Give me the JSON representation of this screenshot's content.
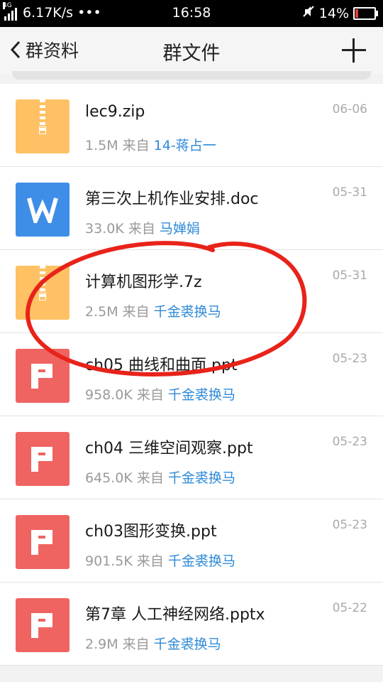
{
  "status_bar": {
    "network_speed": "6.17K/s",
    "dots": "•••",
    "time": "16:58",
    "battery_percent": "14%",
    "signal_tag": "4G",
    "battery_level": 0.14
  },
  "nav": {
    "back_label": "群资料",
    "title": "群文件"
  },
  "files": [
    {
      "name": "lec9.zip",
      "size": "1.5M",
      "from_label": "来自",
      "sender": "14-蒋占一",
      "date": "06-06",
      "type": "zip"
    },
    {
      "name": "第三次上机作业安排.doc",
      "size": "33.0K",
      "from_label": "来自",
      "sender": "马婵娟",
      "date": "05-31",
      "type": "word"
    },
    {
      "name": "计算机图形学.7z",
      "size": "2.5M",
      "from_label": "来自",
      "sender": "千金裘换马",
      "date": "05-31",
      "type": "zip"
    },
    {
      "name": "ch05 曲线和曲面.ppt",
      "size": "958.0K",
      "from_label": "来自",
      "sender": "千金裘换马",
      "date": "05-23",
      "type": "ppt"
    },
    {
      "name": "ch04 三维空间观察.ppt",
      "size": "645.0K",
      "from_label": "来自",
      "sender": "千金裘换马",
      "date": "05-23",
      "type": "ppt"
    },
    {
      "name": "ch03图形变换.ppt",
      "size": "901.5K",
      "from_label": "来自",
      "sender": "千金裘换马",
      "date": "05-23",
      "type": "ppt"
    },
    {
      "name": "第7章  人工神经网络.pptx",
      "size": "2.9M",
      "from_label": "来自",
      "sender": "千金裘换马",
      "date": "05-22",
      "type": "ppt"
    }
  ],
  "colors": {
    "zip": "#ffc164",
    "word": "#3e8ee8",
    "ppt": "#ef6461",
    "sender_link": "#2f8ad8",
    "annotation": "#e8231a"
  }
}
